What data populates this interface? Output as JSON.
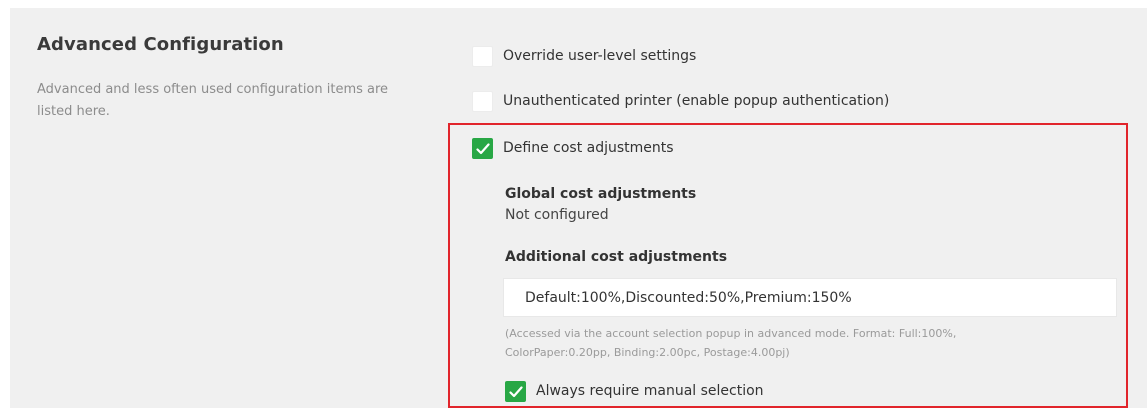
{
  "section": {
    "title": "Advanced Configuration",
    "description": "Advanced and less often used configuration items are listed here."
  },
  "options": {
    "override_user_level": {
      "label": "Override user-level settings",
      "checked": false
    },
    "unauthenticated_printer": {
      "label": "Unauthenticated printer (enable popup authentication)",
      "checked": false
    },
    "define_cost_adjustments": {
      "label": "Define cost adjustments",
      "checked": true
    }
  },
  "cost_adjustments": {
    "global_heading": "Global cost adjustments",
    "global_value": "Not configured",
    "additional_heading": "Additional cost adjustments",
    "additional_value": "Default:100%,Discounted:50%,Premium:150%",
    "help_text": "(Accessed via the account selection popup in advanced mode. Format: Full:100%, ColorPaper:0.20pp, Binding:2.00pc, Postage:4.00pj)",
    "always_require_manual": {
      "label": "Always require manual selection",
      "checked": true
    }
  },
  "colors": {
    "checkbox_checked": "#28a745",
    "highlight_border": "#e1242b",
    "panel_background": "#f0f0f0"
  }
}
